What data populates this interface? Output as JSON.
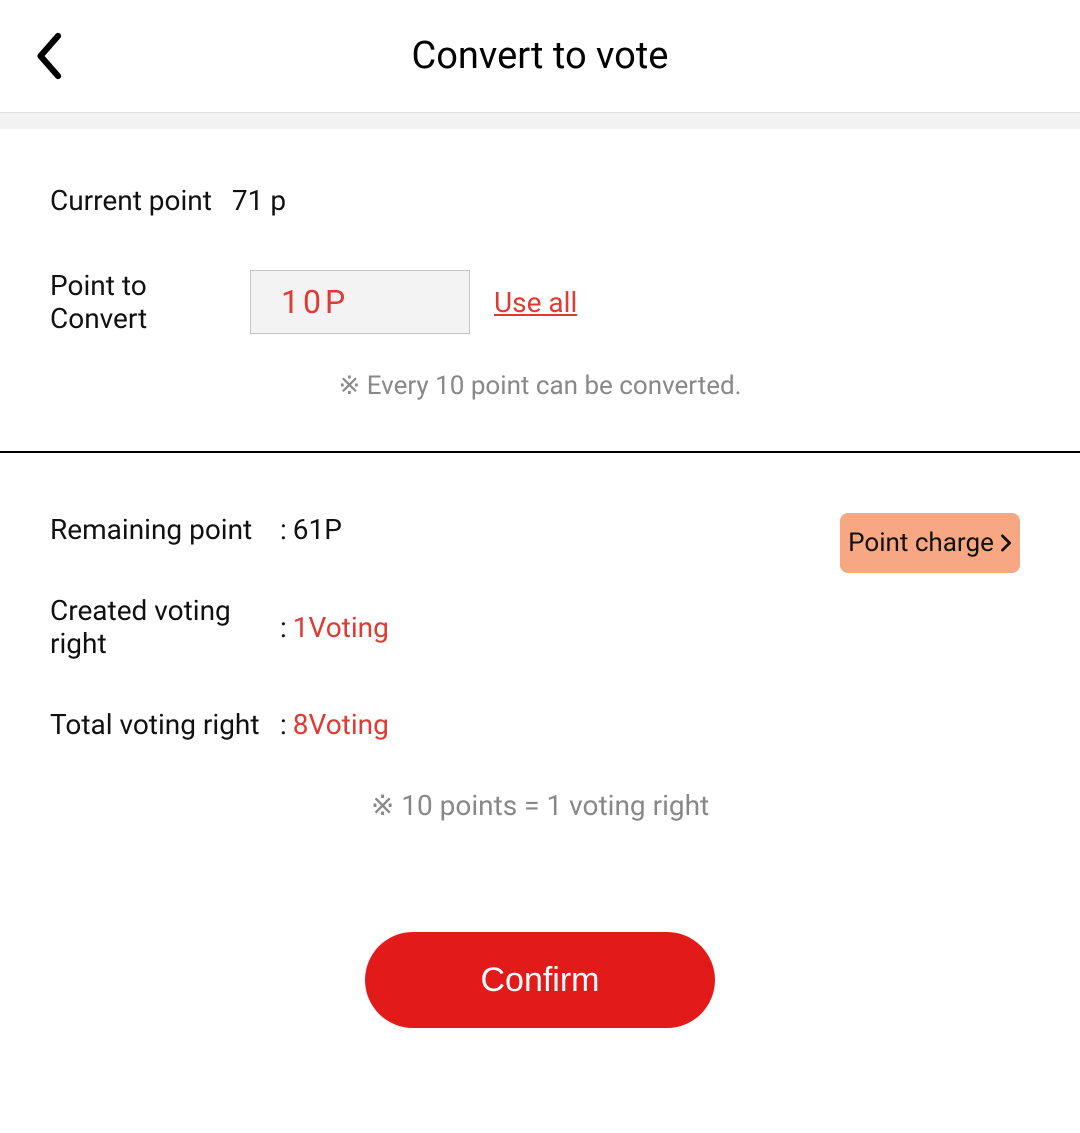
{
  "header": {
    "title": "Convert to vote"
  },
  "top": {
    "current_point_label": "Current point",
    "current_point_value": "71 p",
    "point_to_convert_label": "Point to Convert",
    "point_to_convert_value": "10P",
    "use_all_label": "Use all",
    "note": "※ Every 10 point can be converted."
  },
  "bottom": {
    "remaining_point_label": "Remaining point",
    "remaining_point_value": "61P",
    "created_voting_right_label": "Created voting right",
    "created_voting_right_value": "1Voting",
    "total_voting_right_label": "Total voting right",
    "total_voting_right_value": "8Voting",
    "point_charge_label": "Point charge",
    "note": "※ 10 points = 1 voting right",
    "confirm_label": "Confirm"
  }
}
